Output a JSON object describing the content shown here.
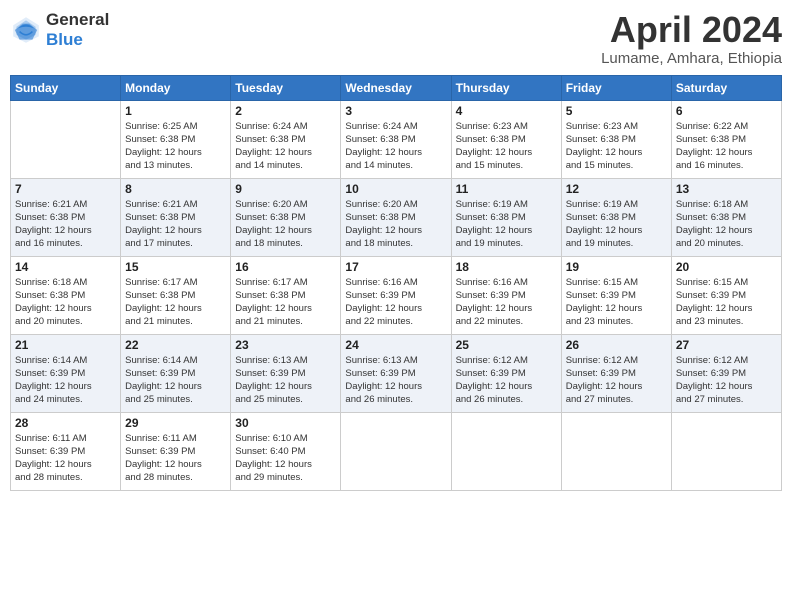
{
  "logo": {
    "general": "General",
    "blue": "Blue"
  },
  "title": "April 2024",
  "location": "Lumame, Amhara, Ethiopia",
  "weekdays": [
    "Sunday",
    "Monday",
    "Tuesday",
    "Wednesday",
    "Thursday",
    "Friday",
    "Saturday"
  ],
  "weeks": [
    [
      {
        "day": null,
        "sunrise": null,
        "sunset": null,
        "daylight": null
      },
      {
        "day": "1",
        "sunrise": "6:25 AM",
        "sunset": "6:38 PM",
        "daylight": "12 hours and 13 minutes."
      },
      {
        "day": "2",
        "sunrise": "6:24 AM",
        "sunset": "6:38 PM",
        "daylight": "12 hours and 14 minutes."
      },
      {
        "day": "3",
        "sunrise": "6:24 AM",
        "sunset": "6:38 PM",
        "daylight": "12 hours and 14 minutes."
      },
      {
        "day": "4",
        "sunrise": "6:23 AM",
        "sunset": "6:38 PM",
        "daylight": "12 hours and 15 minutes."
      },
      {
        "day": "5",
        "sunrise": "6:23 AM",
        "sunset": "6:38 PM",
        "daylight": "12 hours and 15 minutes."
      },
      {
        "day": "6",
        "sunrise": "6:22 AM",
        "sunset": "6:38 PM",
        "daylight": "12 hours and 16 minutes."
      }
    ],
    [
      {
        "day": "7",
        "sunrise": "6:21 AM",
        "sunset": "6:38 PM",
        "daylight": "12 hours and 16 minutes."
      },
      {
        "day": "8",
        "sunrise": "6:21 AM",
        "sunset": "6:38 PM",
        "daylight": "12 hours and 17 minutes."
      },
      {
        "day": "9",
        "sunrise": "6:20 AM",
        "sunset": "6:38 PM",
        "daylight": "12 hours and 18 minutes."
      },
      {
        "day": "10",
        "sunrise": "6:20 AM",
        "sunset": "6:38 PM",
        "daylight": "12 hours and 18 minutes."
      },
      {
        "day": "11",
        "sunrise": "6:19 AM",
        "sunset": "6:38 PM",
        "daylight": "12 hours and 19 minutes."
      },
      {
        "day": "12",
        "sunrise": "6:19 AM",
        "sunset": "6:38 PM",
        "daylight": "12 hours and 19 minutes."
      },
      {
        "day": "13",
        "sunrise": "6:18 AM",
        "sunset": "6:38 PM",
        "daylight": "12 hours and 20 minutes."
      }
    ],
    [
      {
        "day": "14",
        "sunrise": "6:18 AM",
        "sunset": "6:38 PM",
        "daylight": "12 hours and 20 minutes."
      },
      {
        "day": "15",
        "sunrise": "6:17 AM",
        "sunset": "6:38 PM",
        "daylight": "12 hours and 21 minutes."
      },
      {
        "day": "16",
        "sunrise": "6:17 AM",
        "sunset": "6:38 PM",
        "daylight": "12 hours and 21 minutes."
      },
      {
        "day": "17",
        "sunrise": "6:16 AM",
        "sunset": "6:39 PM",
        "daylight": "12 hours and 22 minutes."
      },
      {
        "day": "18",
        "sunrise": "6:16 AM",
        "sunset": "6:39 PM",
        "daylight": "12 hours and 22 minutes."
      },
      {
        "day": "19",
        "sunrise": "6:15 AM",
        "sunset": "6:39 PM",
        "daylight": "12 hours and 23 minutes."
      },
      {
        "day": "20",
        "sunrise": "6:15 AM",
        "sunset": "6:39 PM",
        "daylight": "12 hours and 23 minutes."
      }
    ],
    [
      {
        "day": "21",
        "sunrise": "6:14 AM",
        "sunset": "6:39 PM",
        "daylight": "12 hours and 24 minutes."
      },
      {
        "day": "22",
        "sunrise": "6:14 AM",
        "sunset": "6:39 PM",
        "daylight": "12 hours and 25 minutes."
      },
      {
        "day": "23",
        "sunrise": "6:13 AM",
        "sunset": "6:39 PM",
        "daylight": "12 hours and 25 minutes."
      },
      {
        "day": "24",
        "sunrise": "6:13 AM",
        "sunset": "6:39 PM",
        "daylight": "12 hours and 26 minutes."
      },
      {
        "day": "25",
        "sunrise": "6:12 AM",
        "sunset": "6:39 PM",
        "daylight": "12 hours and 26 minutes."
      },
      {
        "day": "26",
        "sunrise": "6:12 AM",
        "sunset": "6:39 PM",
        "daylight": "12 hours and 27 minutes."
      },
      {
        "day": "27",
        "sunrise": "6:12 AM",
        "sunset": "6:39 PM",
        "daylight": "12 hours and 27 minutes."
      }
    ],
    [
      {
        "day": "28",
        "sunrise": "6:11 AM",
        "sunset": "6:39 PM",
        "daylight": "12 hours and 28 minutes."
      },
      {
        "day": "29",
        "sunrise": "6:11 AM",
        "sunset": "6:39 PM",
        "daylight": "12 hours and 28 minutes."
      },
      {
        "day": "30",
        "sunrise": "6:10 AM",
        "sunset": "6:40 PM",
        "daylight": "12 hours and 29 minutes."
      },
      {
        "day": null,
        "sunrise": null,
        "sunset": null,
        "daylight": null
      },
      {
        "day": null,
        "sunrise": null,
        "sunset": null,
        "daylight": null
      },
      {
        "day": null,
        "sunrise": null,
        "sunset": null,
        "daylight": null
      },
      {
        "day": null,
        "sunrise": null,
        "sunset": null,
        "daylight": null
      }
    ]
  ],
  "labels": {
    "sunrise": "Sunrise:",
    "sunset": "Sunset:",
    "daylight": "Daylight:"
  }
}
